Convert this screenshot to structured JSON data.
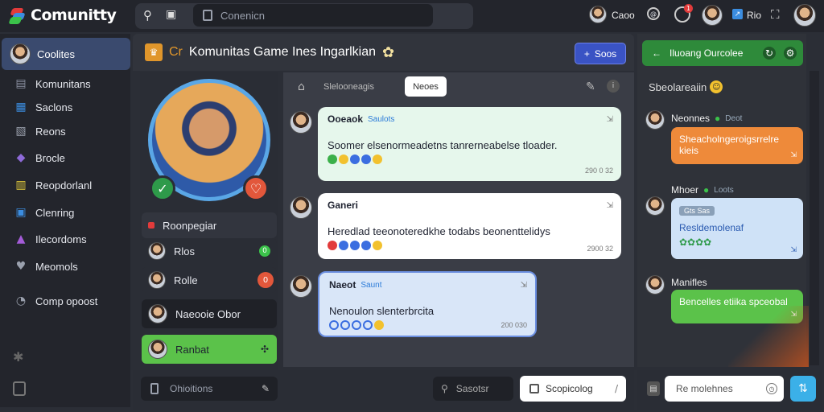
{
  "app": {
    "title": "Comunitty"
  },
  "topbar": {
    "search_placeholder": "Conenicn",
    "user_name": "Caoo",
    "notif_count": "1",
    "status_text": "Rio"
  },
  "sidebar": {
    "header": "Coolites",
    "items": [
      {
        "label": "Komunitans",
        "icon": "people-icon",
        "color": "#8a8fa0"
      },
      {
        "label": "Saclons",
        "icon": "grid-icon",
        "color": "#3b8de0"
      },
      {
        "label": "Reons",
        "icon": "image-icon",
        "color": "#9aa0ad"
      },
      {
        "label": "Brocle",
        "icon": "gamepad-icon",
        "color": "#8e6ad8"
      },
      {
        "label": "Reopdorlanl",
        "icon": "chart-icon",
        "color": "#e0c93b"
      },
      {
        "label": "Clenring",
        "icon": "book-icon",
        "color": "#3b8de0"
      },
      {
        "label": "Ilecordoms",
        "icon": "triangle-icon",
        "color": "#a45cd8"
      },
      {
        "label": "Meomols",
        "icon": "heart-icon",
        "color": "#9aa0ad"
      },
      {
        "label": "Comp opoost",
        "icon": "clock-icon",
        "color": "#9aa0ad"
      }
    ]
  },
  "channel": {
    "title": "Komunitas Game Ines Ingarlkian",
    "prefix": "Cr",
    "button": "Soos"
  },
  "profile": {
    "cards": [
      {
        "label": "Roonpegiar"
      },
      {
        "label": "Rlos",
        "badge": "0"
      },
      {
        "label": "Rolle",
        "badge": "0"
      },
      {
        "label": "Naeooie Obor"
      },
      {
        "label": "Ranbat"
      }
    ]
  },
  "tabs": {
    "left": "Slelooneagis",
    "active": "Neoes"
  },
  "messages": [
    {
      "name": "Ooeaok",
      "tag": "Saulots",
      "text": "Soomer elsenormeadetns tanrerneabelse tloader.",
      "time": "290 0 32"
    },
    {
      "name": "Ganeri",
      "tag": "",
      "text": "Heredlad teeonoteredkhe todabs beonenttelidys",
      "time": "2900 32"
    },
    {
      "name": "Naeot",
      "tag": "Saunt",
      "text": "Nenoulon slenterbrcita",
      "time": "200 030"
    }
  ],
  "right": {
    "header": "Iluoang Ourcolee",
    "section": "Sbeolareaiin",
    "users": [
      {
        "name": "Neonnes",
        "status": "Deot",
        "bubble": "Sheacholngeroigsrrelre kieis"
      },
      {
        "name": "Mhoer",
        "status": "Loots",
        "chip": "Gts Sas",
        "bubble": "Resldemolenaf"
      },
      {
        "name": "Manifles",
        "status": "",
        "bubble": "Bencelles etiika spceobal"
      }
    ]
  },
  "bottom": {
    "composer_placeholder": "Ohioitions",
    "search_label": "Sasotsr",
    "input_label": "Scopicolog",
    "right_input_placeholder": "Re molehnes"
  },
  "colors": {
    "accent": "#3a53c4",
    "green": "#2e8a3a",
    "orange": "#ee8a3a",
    "light_blue": "#cfe2f7",
    "lime": "#5bc24a"
  }
}
